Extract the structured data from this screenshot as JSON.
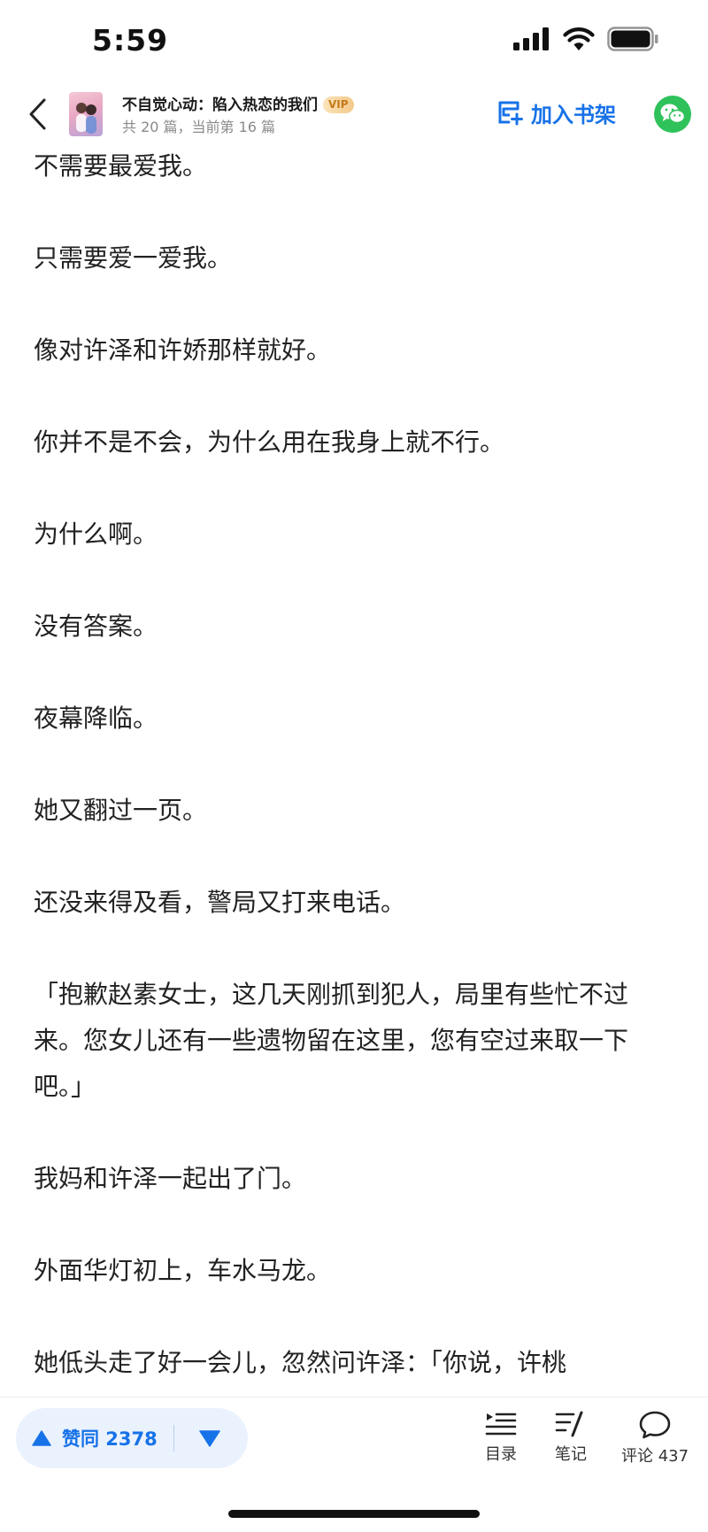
{
  "status_bar": {
    "time": "5:59"
  },
  "header": {
    "book_title": "不自觉心动：陷入热恋的我们",
    "vip_badge": "VIP",
    "subtitle": "共 20 篇，当前第 16 篇",
    "shelf_label": "加入书架"
  },
  "article": {
    "paragraphs": [
      "不需要最爱我。",
      "只需要爱一爱我。",
      "像对许泽和许娇那样就好。",
      "你并不是不会，为什么用在我身上就不行。",
      "为什么啊。",
      "没有答案。",
      "夜幕降临。",
      "她又翻过一页。",
      "还没来得及看，警局又打来电话。",
      "「抱歉赵素女士，这几天刚抓到犯人，局里有些忙不过来。您女儿还有一些遗物留在这里，您有空过来取一下吧。」",
      "我妈和许泽一起出了门。",
      "外面华灯初上，车水马龙。",
      "她低头走了好一会儿，忽然问许泽：「你说，许桃"
    ]
  },
  "bottom_bar": {
    "vote_label": "赞同 2378",
    "toc_label": "目录",
    "notes_label": "笔记",
    "comments_label": "评论 437"
  },
  "colors": {
    "accent": "#1772e8",
    "wechat": "#2fc25b",
    "vote_bg": "#eaf2fe"
  }
}
